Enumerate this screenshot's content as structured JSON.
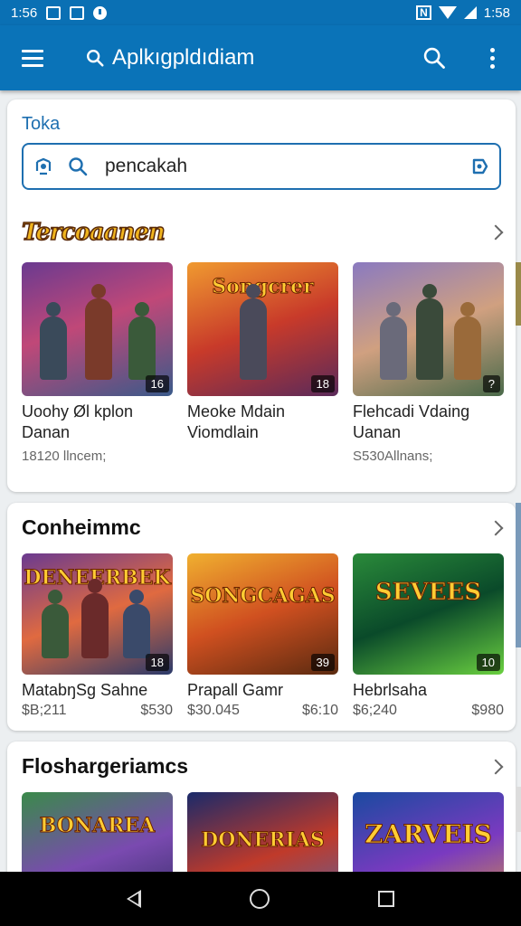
{
  "status_bar": {
    "time_left": "1:56",
    "time_right": "1:58",
    "n_badge": "N"
  },
  "app_bar": {
    "title": "Aplkıgpldıdiam",
    "icons": [
      "menu-icon",
      "search-icon",
      "overflow-menu-icon"
    ]
  },
  "search": {
    "label": "Toka",
    "query": "pencakah"
  },
  "sections": [
    {
      "title": "Tercoaanen",
      "items": [
        {
          "name": "Uoohy Øl kplon Danan",
          "meta": "18120 llncem;",
          "badge": "16"
        },
        {
          "name": "Meoke Mdain Viomdlain",
          "meta": "",
          "badge": "18",
          "art_title": "Songcrer"
        },
        {
          "name": "Flehcadi Vdaing Uanan",
          "meta": "S530Allnans;",
          "badge": "?"
        }
      ]
    },
    {
      "title": "Conheimmc",
      "items": [
        {
          "name": "MatabŋSg Sahne",
          "price_left": "$B;211",
          "price_right": "$530",
          "badge": "18",
          "art_title": "DENEERBEK"
        },
        {
          "name": "Prapall Gamr",
          "price_left": "$30.045",
          "price_right": "$6:10",
          "badge": "39",
          "art_title": "SONGCAGAS"
        },
        {
          "name": "Hebrlsaha",
          "price_left": "$6;240",
          "price_right": "$980",
          "badge": "10",
          "art_title": "SEVEES"
        }
      ]
    },
    {
      "title": "Floshargeriamcs",
      "items": [
        {
          "art_title": "BONAREA"
        },
        {
          "art_title": "DONERIAS"
        },
        {
          "art_title": "ZARVEIS"
        }
      ]
    }
  ],
  "colors": {
    "app_bar": "#0a73b8",
    "accent": "#1e6fb0",
    "nav_bar": "#000000"
  }
}
